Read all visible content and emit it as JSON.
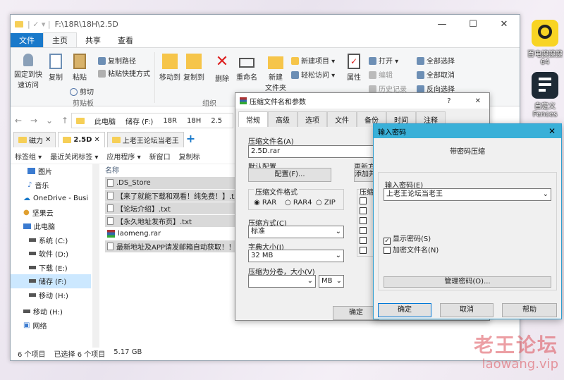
{
  "desktop": {
    "icons": [
      {
        "label": "百电搜搜搜\n64"
      },
      {
        "label": "自定义\nFences"
      }
    ]
  },
  "explorer": {
    "title": "F:\\18R\\18H\\2.5D",
    "menu_tabs": [
      "文件",
      "主页",
      "共享",
      "查看"
    ],
    "ribbon": {
      "pin_label": "固定到快\n速访问",
      "copy_label": "复制",
      "paste_label": "粘贴",
      "copy_path_label": "复制路径",
      "paste_shortcut_label": "粘贴快捷方式",
      "cut_label": "剪切",
      "clipboard_group": "剪贴板",
      "move_to_label": "移动到",
      "copy_to_label": "复制到",
      "delete_label": "删除",
      "rename_label": "重命名",
      "organize_group": "组织",
      "new_folder_label": "新建\n文件夹",
      "new_item_label": "新建项目 ▾",
      "easy_access_label": "轻松访问 ▾",
      "properties_label": "属性",
      "open_label": "打开 ▾",
      "edit_label": "编辑",
      "history_label": "历史记录",
      "select_all_label": "全部选择",
      "select_none_label": "全部取消",
      "invert_label": "反向选择"
    },
    "breadcrumb": [
      "此电脑",
      "储存 (F:)",
      "18R",
      "18H",
      "2.5"
    ],
    "tabs": [
      "磁力",
      "2.5D",
      "上老王论坛当老王"
    ],
    "toolbar": [
      "标签组 ▾",
      "最近关闭标签 ▾",
      "应用程序 ▾",
      "新窗口",
      "复制标"
    ],
    "sidebar": [
      "图片",
      "音乐",
      "OneDrive - Busi",
      "坚果云",
      "此电脑",
      "系统 (C:)",
      "软件 (D:)",
      "下载 (E:)",
      "储存 (F:)",
      "移动 (H:)",
      "移动 (H:)",
      "网络"
    ],
    "column_name": "名称",
    "files": [
      ".DS_Store",
      "【来了就能下载和观看！纯免费！】.txt",
      "【论坛介绍】.txt",
      "【永久地址发布页】.txt",
      "laomeng.rar",
      "最新地址及APP请发邮箱自动获取！！！"
    ],
    "status": {
      "count": "6 个项目",
      "selected": "已选择 6 个项目",
      "size": "5.17 GB"
    }
  },
  "rar_dialog": {
    "title": "压缩文件名和参数",
    "tabs": [
      "常规",
      "高级",
      "选项",
      "文件",
      "备份",
      "时间",
      "注释"
    ],
    "archive_name_label": "压缩文件名(A)",
    "archive_name": "2.5D.rar",
    "profile_label": "默认配置",
    "profile_button": "配置(F)...",
    "format_label": "压缩文件格式",
    "formats": [
      "RAR",
      "RAR4",
      "ZIP"
    ],
    "method_label": "压缩方式(C)",
    "method": "标准",
    "dict_label": "字典大小(I)",
    "dict": "32 MB",
    "split_label": "压缩为分卷，大小(V)",
    "split_unit": "MB",
    "update_label": "更新方",
    "add_button": "添加并",
    "options_label": "压缩",
    "ok": "确定"
  },
  "password_dialog": {
    "title": "输入密码",
    "heading": "带密码压缩",
    "input_label": "输入密码(E)",
    "password": "上老王论坛当老王",
    "show_password": "显示密码(S)",
    "encrypt_names": "加密文件名(N)",
    "manage_button": "管理密码(O)...",
    "ok": "确定",
    "cancel": "取消",
    "help": "帮助"
  },
  "watermark": {
    "line1": "老王论坛",
    "line2": "laowang.vip"
  }
}
